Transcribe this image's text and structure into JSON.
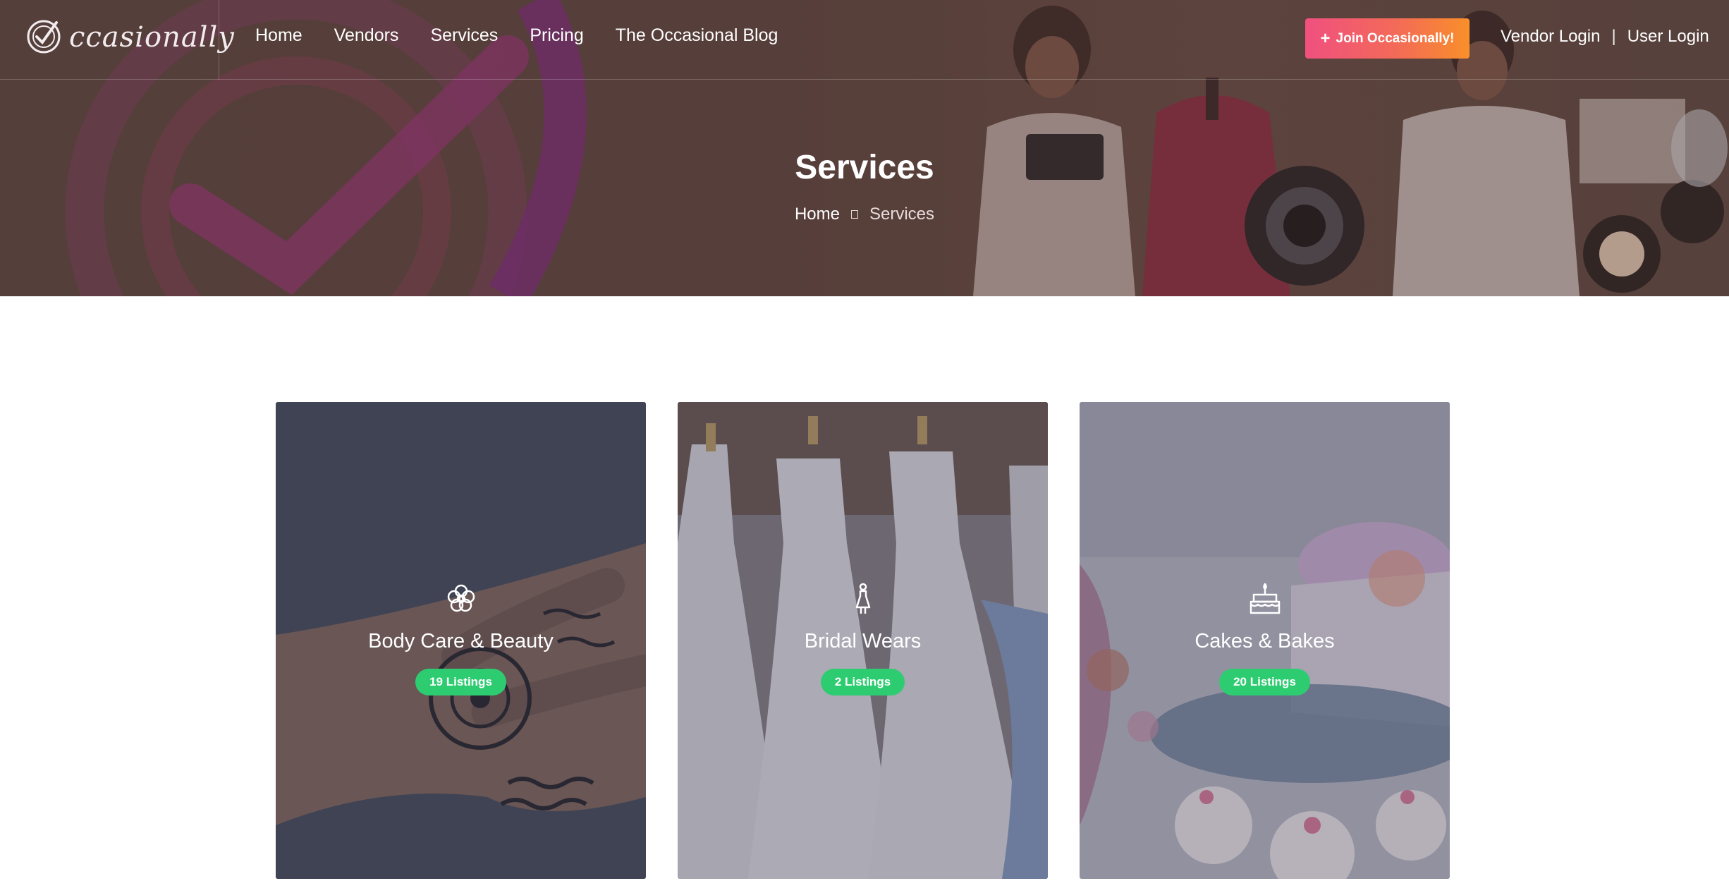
{
  "brand": {
    "logo_text": "ccasionally"
  },
  "nav": {
    "items": [
      {
        "label": "Home"
      },
      {
        "label": "Vendors"
      },
      {
        "label": "Services"
      },
      {
        "label": "Pricing"
      },
      {
        "label": "The Occasional Blog"
      }
    ]
  },
  "header": {
    "join_label": "Join Occasionally!",
    "vendor_login": "Vendor Login",
    "separator": "|",
    "user_login": "User Login"
  },
  "hero": {
    "title": "Services",
    "breadcrumb": {
      "home": "Home",
      "current": "Services"
    }
  },
  "services": [
    {
      "title": "Body Care & Beauty",
      "badge": "19 Listings",
      "icon": "flower-icon"
    },
    {
      "title": "Bridal Wears",
      "badge": "2 Listings",
      "icon": "bride-icon"
    },
    {
      "title": "Cakes & Bakes",
      "badge": "20 Listings",
      "icon": "cake-icon"
    }
  ],
  "colors": {
    "join_gradient_start": "#f0507f",
    "join_gradient_end": "#f98f2a",
    "badge_green": "#2ecc71",
    "hero_brown": "#5b4540",
    "logo_purple": "#8a2a8c"
  }
}
